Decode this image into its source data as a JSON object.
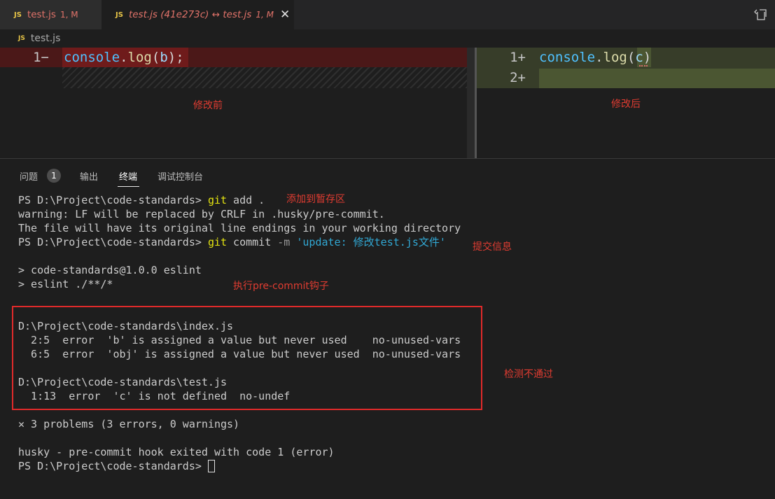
{
  "tabs": [
    {
      "badge": "JS",
      "label": "test.js",
      "status": "1, M"
    },
    {
      "badge": "JS",
      "label": "test.js (41e273c) ↔ test.js",
      "status": "1, M",
      "close": "✕"
    }
  ],
  "breadcrumb": {
    "badge": "JS",
    "file": "test.js"
  },
  "diff": {
    "left": {
      "line_number": "1−",
      "tokens": {
        "obj": "console",
        "dot": ".",
        "method": "log",
        "open": "(",
        "arg": "b",
        "close": ");"
      }
    },
    "right": {
      "line1_number": "1+",
      "line2_number": "2+",
      "tokens": {
        "obj": "console",
        "dot": ".",
        "method": "log",
        "open": "(",
        "arg": "c",
        "close": ")"
      }
    }
  },
  "annotations": {
    "before": "修改前",
    "after": "修改后",
    "staging": "添加到暂存区",
    "commit_msg": "提交信息",
    "hook": "执行pre-commit钩子",
    "failed": "检测不通过"
  },
  "panel": {
    "tabs": [
      "问题",
      "输出",
      "终端",
      "调试控制台"
    ],
    "problems_count": "1",
    "active_tab": "终端"
  },
  "terminal": {
    "prompt": "PS D:\\Project\\code-standards>",
    "cmd1_git": "git",
    "cmd1_rest": " add .",
    "line2": "warning: LF will be replaced by CRLF in .husky/pre-commit.",
    "line3": "The file will have its original line endings in your working directory",
    "cmd2_git": "git",
    "cmd2_commit": " commit ",
    "cmd2_flag": "-m",
    "cmd2_msg": " 'update: 修改test.js文件'",
    "line5": "> code-standards@1.0.0 eslint",
    "line6": "> eslint ./**/*",
    "file1": "D:\\Project\\code-standards\\index.js",
    "err1": "  2:5  error  'b' is assigned a value but never used    no-unused-vars",
    "err2": "  6:5  error  'obj' is assigned a value but never used  no-unused-vars",
    "file2": "D:\\Project\\code-standards\\test.js",
    "err3": "  1:13  error  'c' is not defined  no-undef",
    "summary_icon": "✕",
    "summary": " 3 problems (3 errors, 0 warnings)",
    "husky": "husky - pre-commit hook exited with code 1 (error)"
  }
}
